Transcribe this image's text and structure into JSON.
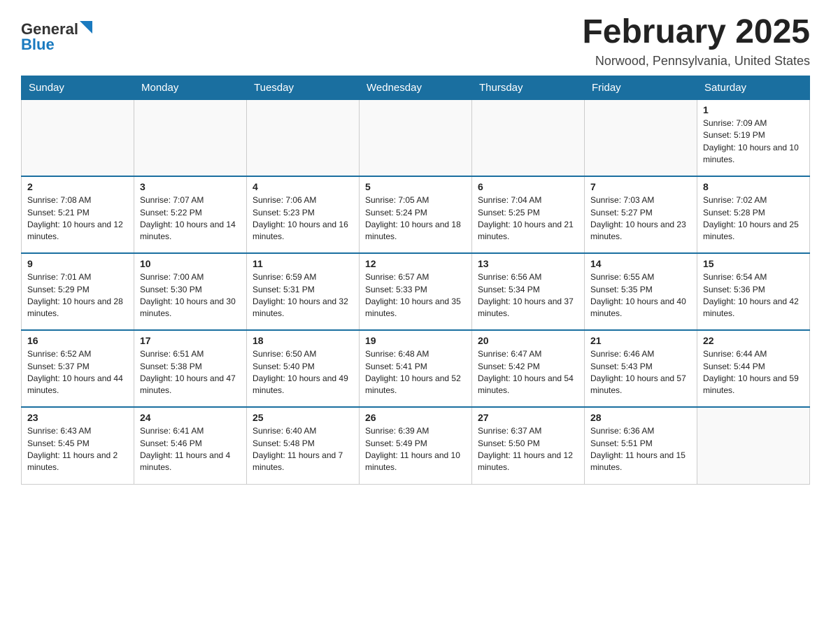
{
  "header": {
    "logo_general": "General",
    "logo_blue": "Blue",
    "month_title": "February 2025",
    "location": "Norwood, Pennsylvania, United States"
  },
  "days_of_week": [
    "Sunday",
    "Monday",
    "Tuesday",
    "Wednesday",
    "Thursday",
    "Friday",
    "Saturday"
  ],
  "weeks": [
    [
      {
        "day": "",
        "info": ""
      },
      {
        "day": "",
        "info": ""
      },
      {
        "day": "",
        "info": ""
      },
      {
        "day": "",
        "info": ""
      },
      {
        "day": "",
        "info": ""
      },
      {
        "day": "",
        "info": ""
      },
      {
        "day": "1",
        "info": "Sunrise: 7:09 AM\nSunset: 5:19 PM\nDaylight: 10 hours and 10 minutes."
      }
    ],
    [
      {
        "day": "2",
        "info": "Sunrise: 7:08 AM\nSunset: 5:21 PM\nDaylight: 10 hours and 12 minutes."
      },
      {
        "day": "3",
        "info": "Sunrise: 7:07 AM\nSunset: 5:22 PM\nDaylight: 10 hours and 14 minutes."
      },
      {
        "day": "4",
        "info": "Sunrise: 7:06 AM\nSunset: 5:23 PM\nDaylight: 10 hours and 16 minutes."
      },
      {
        "day": "5",
        "info": "Sunrise: 7:05 AM\nSunset: 5:24 PM\nDaylight: 10 hours and 18 minutes."
      },
      {
        "day": "6",
        "info": "Sunrise: 7:04 AM\nSunset: 5:25 PM\nDaylight: 10 hours and 21 minutes."
      },
      {
        "day": "7",
        "info": "Sunrise: 7:03 AM\nSunset: 5:27 PM\nDaylight: 10 hours and 23 minutes."
      },
      {
        "day": "8",
        "info": "Sunrise: 7:02 AM\nSunset: 5:28 PM\nDaylight: 10 hours and 25 minutes."
      }
    ],
    [
      {
        "day": "9",
        "info": "Sunrise: 7:01 AM\nSunset: 5:29 PM\nDaylight: 10 hours and 28 minutes."
      },
      {
        "day": "10",
        "info": "Sunrise: 7:00 AM\nSunset: 5:30 PM\nDaylight: 10 hours and 30 minutes."
      },
      {
        "day": "11",
        "info": "Sunrise: 6:59 AM\nSunset: 5:31 PM\nDaylight: 10 hours and 32 minutes."
      },
      {
        "day": "12",
        "info": "Sunrise: 6:57 AM\nSunset: 5:33 PM\nDaylight: 10 hours and 35 minutes."
      },
      {
        "day": "13",
        "info": "Sunrise: 6:56 AM\nSunset: 5:34 PM\nDaylight: 10 hours and 37 minutes."
      },
      {
        "day": "14",
        "info": "Sunrise: 6:55 AM\nSunset: 5:35 PM\nDaylight: 10 hours and 40 minutes."
      },
      {
        "day": "15",
        "info": "Sunrise: 6:54 AM\nSunset: 5:36 PM\nDaylight: 10 hours and 42 minutes."
      }
    ],
    [
      {
        "day": "16",
        "info": "Sunrise: 6:52 AM\nSunset: 5:37 PM\nDaylight: 10 hours and 44 minutes."
      },
      {
        "day": "17",
        "info": "Sunrise: 6:51 AM\nSunset: 5:38 PM\nDaylight: 10 hours and 47 minutes."
      },
      {
        "day": "18",
        "info": "Sunrise: 6:50 AM\nSunset: 5:40 PM\nDaylight: 10 hours and 49 minutes."
      },
      {
        "day": "19",
        "info": "Sunrise: 6:48 AM\nSunset: 5:41 PM\nDaylight: 10 hours and 52 minutes."
      },
      {
        "day": "20",
        "info": "Sunrise: 6:47 AM\nSunset: 5:42 PM\nDaylight: 10 hours and 54 minutes."
      },
      {
        "day": "21",
        "info": "Sunrise: 6:46 AM\nSunset: 5:43 PM\nDaylight: 10 hours and 57 minutes."
      },
      {
        "day": "22",
        "info": "Sunrise: 6:44 AM\nSunset: 5:44 PM\nDaylight: 10 hours and 59 minutes."
      }
    ],
    [
      {
        "day": "23",
        "info": "Sunrise: 6:43 AM\nSunset: 5:45 PM\nDaylight: 11 hours and 2 minutes."
      },
      {
        "day": "24",
        "info": "Sunrise: 6:41 AM\nSunset: 5:46 PM\nDaylight: 11 hours and 4 minutes."
      },
      {
        "day": "25",
        "info": "Sunrise: 6:40 AM\nSunset: 5:48 PM\nDaylight: 11 hours and 7 minutes."
      },
      {
        "day": "26",
        "info": "Sunrise: 6:39 AM\nSunset: 5:49 PM\nDaylight: 11 hours and 10 minutes."
      },
      {
        "day": "27",
        "info": "Sunrise: 6:37 AM\nSunset: 5:50 PM\nDaylight: 11 hours and 12 minutes."
      },
      {
        "day": "28",
        "info": "Sunrise: 6:36 AM\nSunset: 5:51 PM\nDaylight: 11 hours and 15 minutes."
      },
      {
        "day": "",
        "info": ""
      }
    ]
  ]
}
